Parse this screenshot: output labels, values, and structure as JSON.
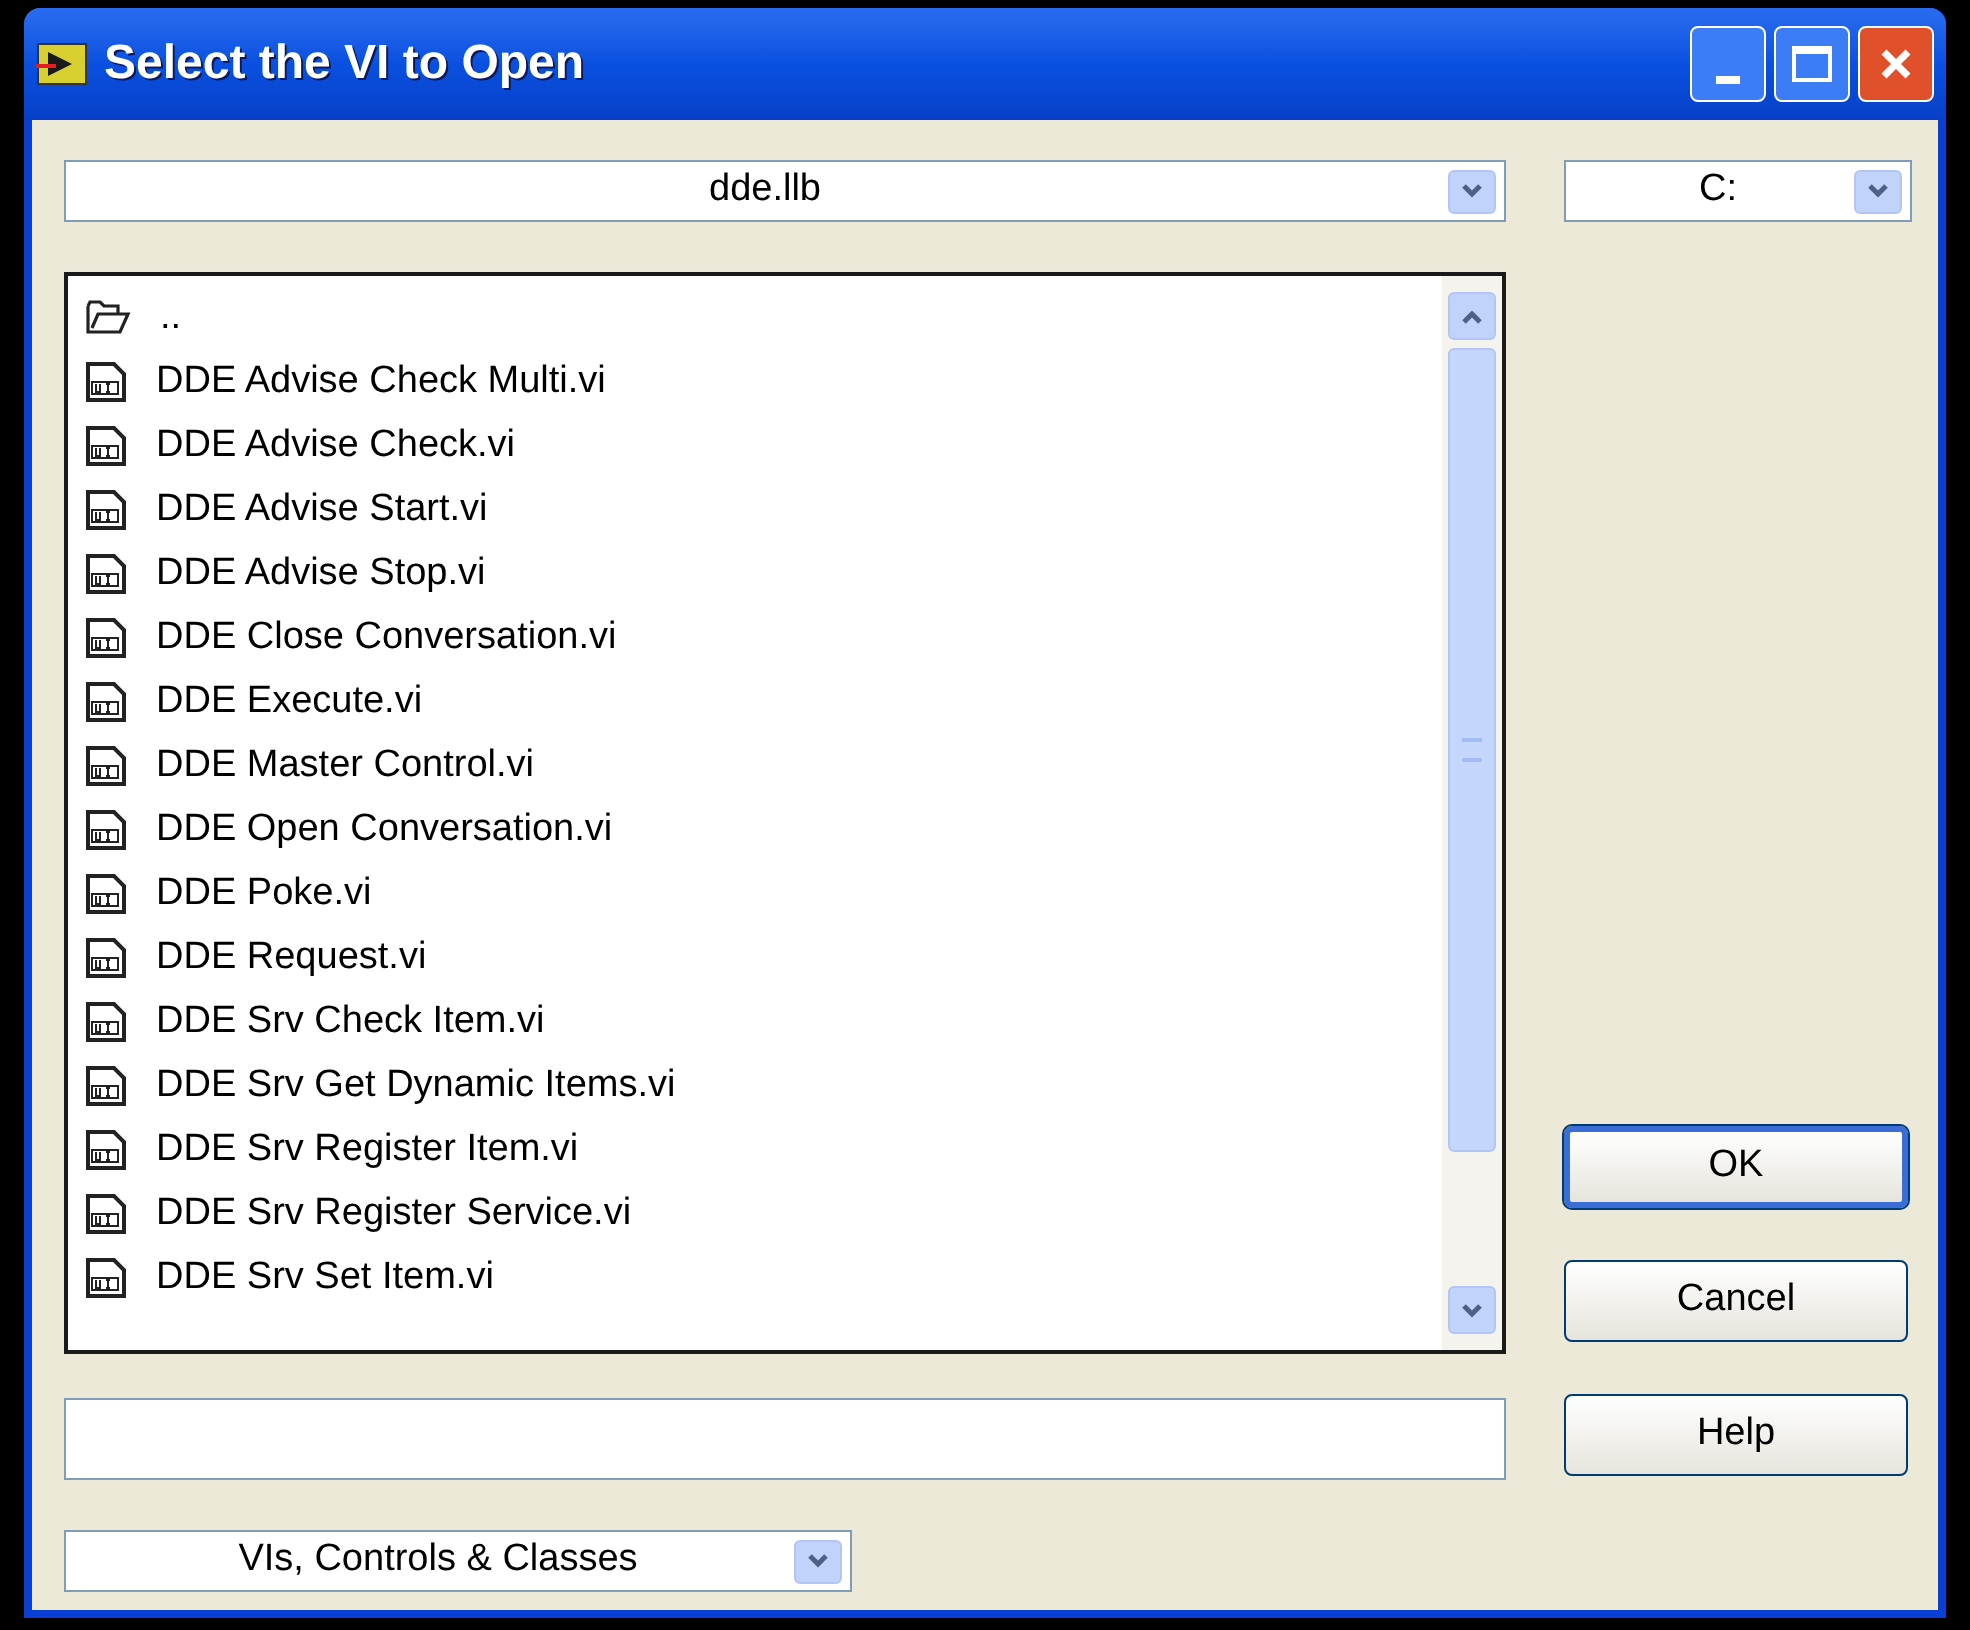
{
  "window": {
    "title": "Select the VI to Open"
  },
  "path_dropdown": {
    "value": "dde.llb"
  },
  "drive_dropdown": {
    "value": "C:"
  },
  "files": [
    {
      "kind": "folder",
      "name": ".."
    },
    {
      "kind": "vi",
      "name": "DDE Advise Check Multi.vi"
    },
    {
      "kind": "vi",
      "name": "DDE Advise Check.vi"
    },
    {
      "kind": "vi",
      "name": "DDE Advise Start.vi"
    },
    {
      "kind": "vi",
      "name": "DDE Advise Stop.vi"
    },
    {
      "kind": "vi",
      "name": "DDE Close Conversation.vi"
    },
    {
      "kind": "vi",
      "name": "DDE Execute.vi"
    },
    {
      "kind": "vi",
      "name": "DDE Master Control.vi"
    },
    {
      "kind": "vi",
      "name": "DDE Open Conversation.vi"
    },
    {
      "kind": "vi",
      "name": "DDE Poke.vi"
    },
    {
      "kind": "vi",
      "name": "DDE Request.vi"
    },
    {
      "kind": "vi",
      "name": "DDE Srv Check Item.vi"
    },
    {
      "kind": "vi",
      "name": "DDE Srv Get Dynamic Items.vi"
    },
    {
      "kind": "vi",
      "name": "DDE Srv Register Item.vi"
    },
    {
      "kind": "vi",
      "name": "DDE Srv Register Service.vi"
    },
    {
      "kind": "vi",
      "name": "DDE Srv Set Item.vi"
    }
  ],
  "buttons": [
    {
      "label": "OK",
      "default": true
    },
    {
      "label": "Cancel",
      "default": false
    },
    {
      "label": "Help",
      "default": false
    }
  ],
  "filter_dropdown": {
    "value": "VIs, Controls & Classes"
  }
}
